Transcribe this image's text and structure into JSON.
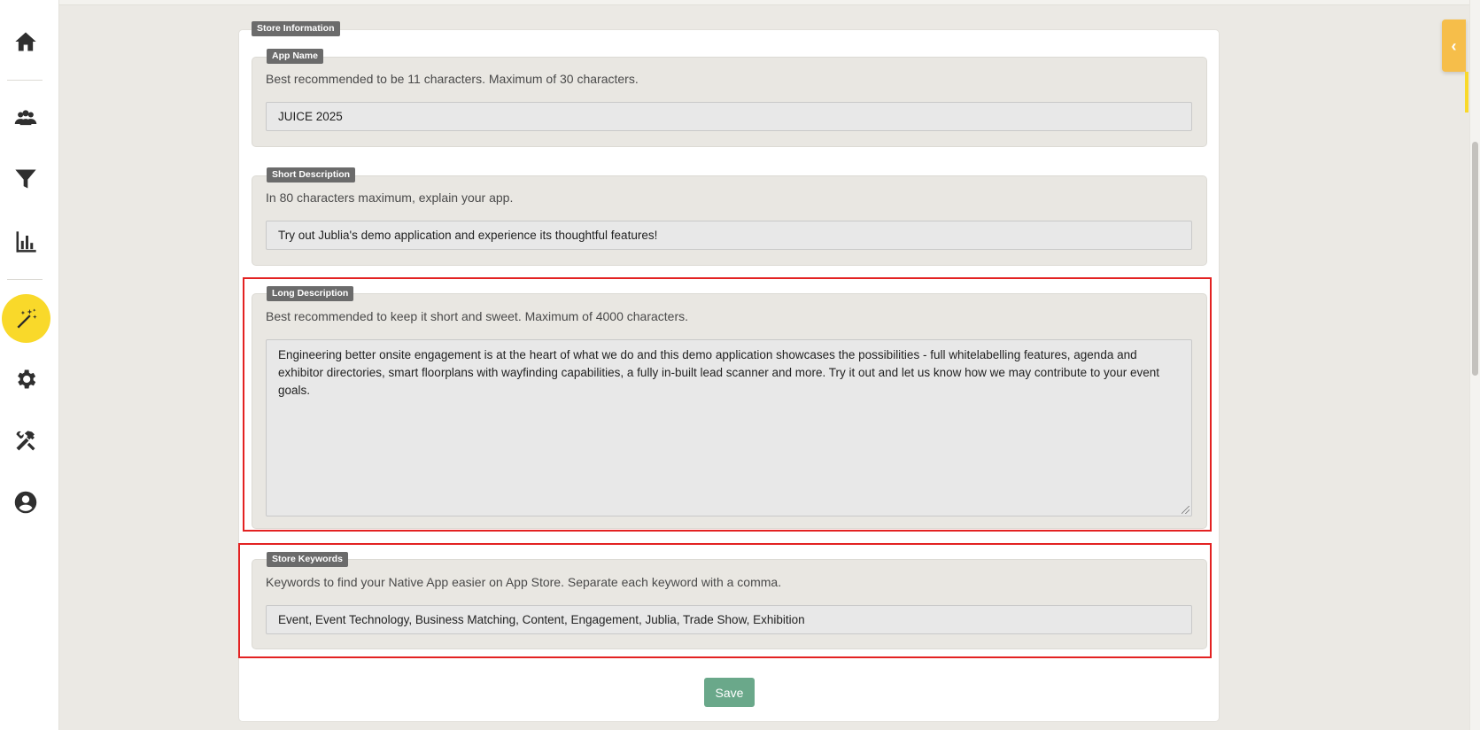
{
  "sidebar": {
    "items": [
      {
        "name": "home",
        "icon": "home-icon"
      },
      {
        "name": "users",
        "icon": "users-icon"
      },
      {
        "name": "filter",
        "icon": "filter-icon"
      },
      {
        "name": "analytics",
        "icon": "bar-chart-icon"
      },
      {
        "name": "app-builder",
        "icon": "magic-wand-icon",
        "active": true
      },
      {
        "name": "settings",
        "icon": "gear-icon"
      },
      {
        "name": "tools",
        "icon": "tools-icon"
      },
      {
        "name": "profile",
        "icon": "user-circle-icon"
      }
    ],
    "active_color": "#f9d92a"
  },
  "store_info": {
    "legend": "Store Information",
    "app_name": {
      "legend": "App Name",
      "hint": "Best recommended to be 11 characters. Maximum of 30 characters.",
      "value": "JUICE 2025"
    },
    "short_description": {
      "legend": "Short Description",
      "hint": "In 80 characters maximum, explain your app.",
      "value": "Try out Jublia's demo application and experience its thoughtful features!"
    },
    "long_description": {
      "legend": "Long Description",
      "hint": "Best recommended to keep it short and sweet. Maximum of 4000 characters.",
      "value": "Engineering better onsite engagement is at the heart of what we do and this demo application showcases the possibilities - full whitelabelling features, agenda and exhibitor directories, smart floorplans with wayfinding capabilities, a fully in-built lead scanner and more. Try it out and let us know how we may contribute to your event goals."
    },
    "store_keywords": {
      "legend": "Store Keywords",
      "hint": "Keywords to find your Native App easier on App Store. Separate each keyword with a comma.",
      "value": "Event, Event Technology, Business Matching, Content, Engagement, Jublia, Trade Show, Exhibition"
    },
    "save_label": "Save"
  },
  "colors": {
    "highlight": "#e32222",
    "save_button": "#6aa88a",
    "side_tab": "#f6be4a"
  }
}
